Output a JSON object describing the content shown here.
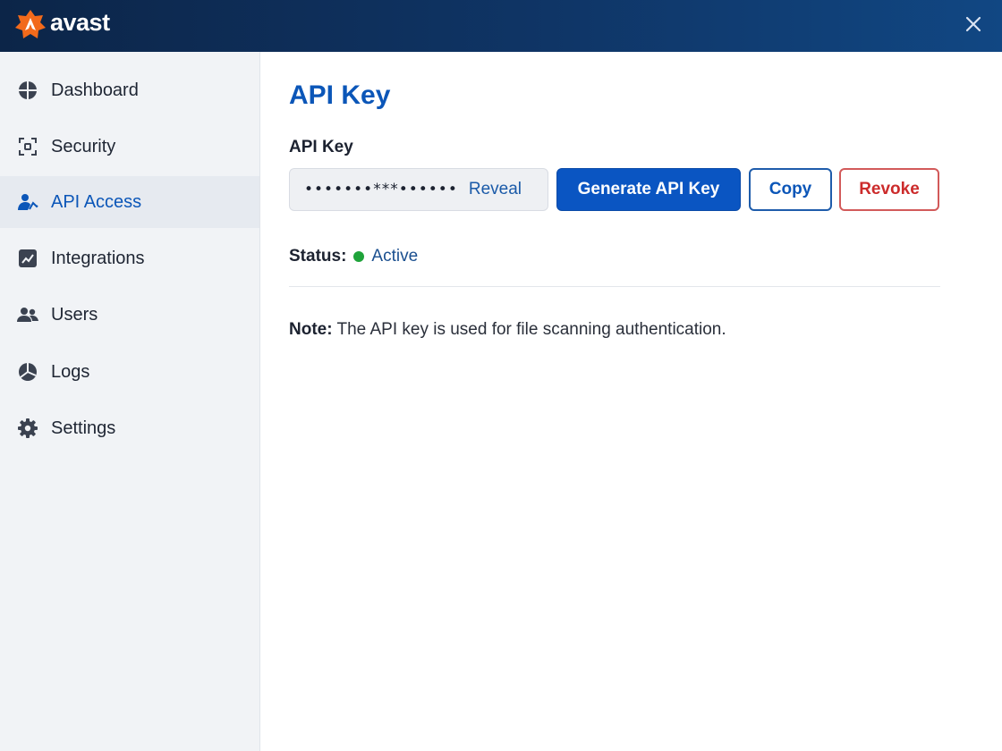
{
  "app": {
    "brand": "avast",
    "brand_color": "#f26a1b",
    "accent_color": "#0b56b8",
    "close_icon": "close-icon"
  },
  "sidebar": {
    "items": [
      {
        "label": "Dashboard",
        "icon": "dashboard-icon",
        "active": false
      },
      {
        "label": "Security",
        "icon": "security-icon",
        "active": false
      },
      {
        "label": "API Access",
        "icon": "api-access-icon",
        "active": true
      },
      {
        "label": "Integrations",
        "icon": "integrations-icon",
        "active": false
      },
      {
        "label": "Users",
        "icon": "users-icon",
        "active": false
      },
      {
        "label": "Logs",
        "icon": "logs-icon",
        "active": false
      },
      {
        "label": "Settings",
        "icon": "gear-icon",
        "active": false
      }
    ]
  },
  "main": {
    "title": "API Key",
    "field_label": "API Key",
    "key_value": "•••••••***••••••",
    "reveal_label": "Reveal",
    "buttons": {
      "generate": "Generate API Key",
      "copy": "Copy",
      "revoke": "Revoke"
    },
    "status": {
      "label": "Status:",
      "value": "Active",
      "color": "#1fa33a"
    },
    "note": {
      "label": "Note:",
      "text": "The API key is used for file scanning authentication."
    }
  }
}
